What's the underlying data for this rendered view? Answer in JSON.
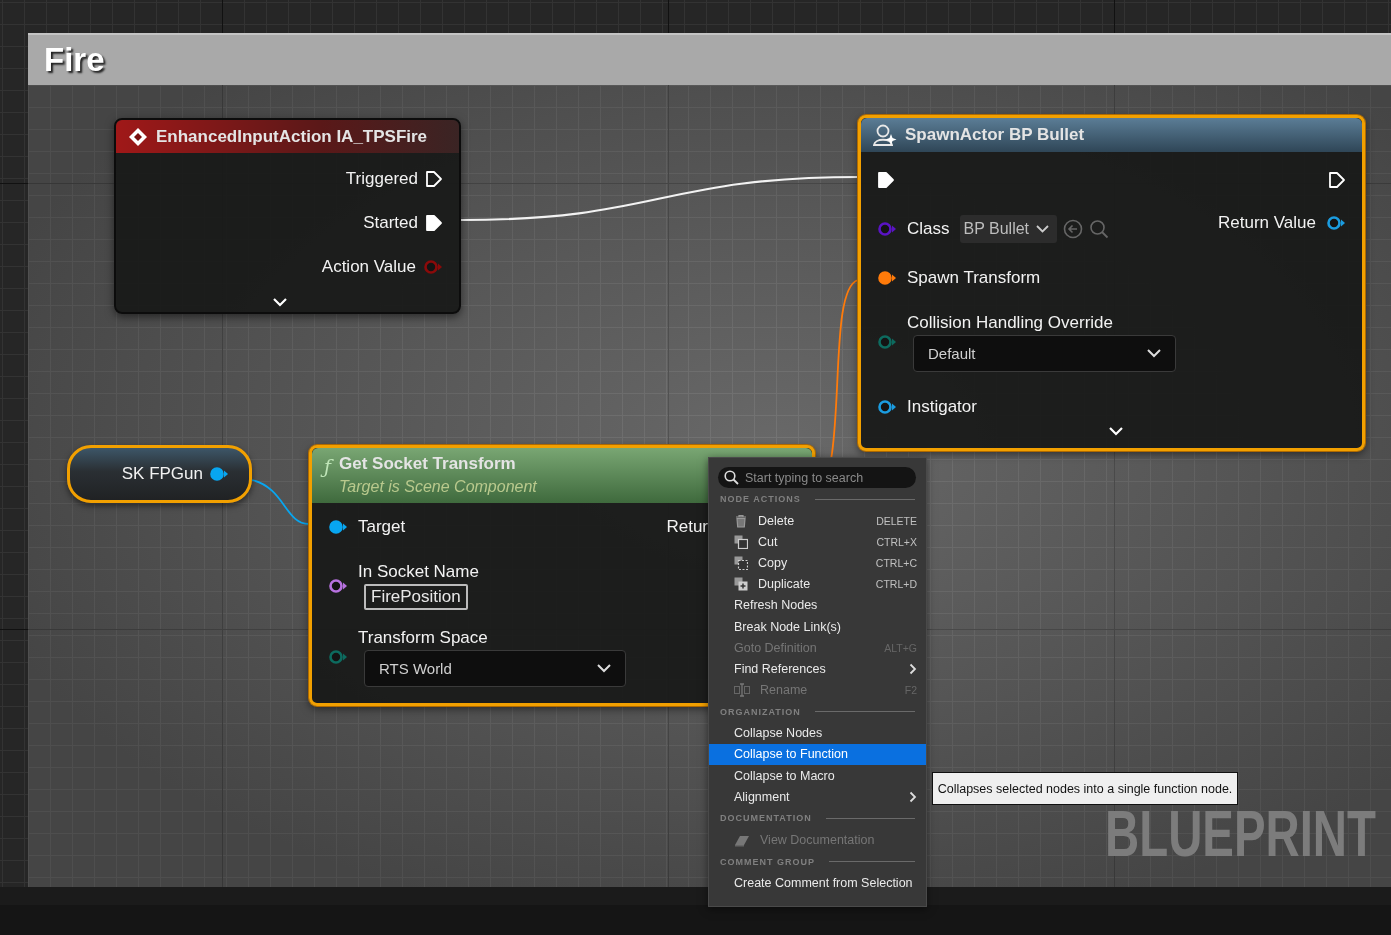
{
  "comment": {
    "title": "Fire"
  },
  "event_node": {
    "title": "EnhancedInputAction IA_TPSFire",
    "selected": false,
    "expandable": true,
    "outputs": [
      {
        "label": "Triggered",
        "kind": "exec",
        "connected": false
      },
      {
        "label": "Started",
        "kind": "exec",
        "connected": true
      },
      {
        "label": "Action Value",
        "kind": "data",
        "color": "#8b0a0a",
        "connected": false
      }
    ]
  },
  "spawn_node": {
    "title": "SpawnActor BP Bullet",
    "selected": true,
    "expandable": true,
    "inputs": [
      {
        "kind": "exec",
        "connected": true
      },
      {
        "label": "Class",
        "kind": "data",
        "color": "#5a14c4",
        "connected": false,
        "combo": "BP Bullet"
      },
      {
        "label": "Spawn Transform",
        "kind": "data",
        "color": "#ff7b0a",
        "connected": true
      },
      {
        "label": "Collision Handling Override",
        "kind": "data",
        "color": "#0d6b5f",
        "connected": false,
        "dropdown": "Default"
      },
      {
        "label": "Instigator",
        "kind": "data",
        "color": "#1b9ce0",
        "connected": false
      }
    ],
    "outputs": [
      {
        "kind": "exec",
        "connected": false
      },
      {
        "label": "Return Value",
        "kind": "data",
        "color": "#1b9ce0",
        "connected": false
      }
    ]
  },
  "variable_node": {
    "label": "SK FPGun",
    "selected": true,
    "pin": {
      "kind": "data",
      "color": "#08a6f0",
      "connected": true
    }
  },
  "function_node": {
    "glyph": "ƒ",
    "title": "Get Socket Transform",
    "subtitle": "Target is Scene Component",
    "selected": true,
    "inputs": [
      {
        "label": "Target",
        "kind": "data",
        "color": "#08a6f0",
        "connected": true
      },
      {
        "label": "In Socket Name",
        "kind": "data",
        "color": "#b872e0",
        "connected": false,
        "text_value": "FirePosition"
      },
      {
        "label": "Transform Space",
        "kind": "data",
        "color": "#0d6b5f",
        "connected": false,
        "dropdown": "RTS World"
      }
    ],
    "outputs": [
      {
        "label": "Retur"
      }
    ]
  },
  "context_menu": {
    "search_placeholder": "Start typing to search",
    "entries": [
      {
        "kind": "heading",
        "label": "NODE ACTIONS"
      },
      {
        "kind": "item",
        "label": "Delete",
        "shortcut": "DELETE",
        "disabled": false,
        "selected": false
      },
      {
        "kind": "item",
        "label": "Cut",
        "shortcut": "CTRL+X",
        "disabled": false,
        "selected": false
      },
      {
        "kind": "item",
        "label": "Copy",
        "shortcut": "CTRL+C",
        "disabled": false,
        "selected": false
      },
      {
        "kind": "item",
        "label": "Duplicate",
        "shortcut": "CTRL+D",
        "disabled": false,
        "selected": false
      },
      {
        "kind": "item",
        "label": "Refresh Nodes",
        "disabled": false,
        "selected": false
      },
      {
        "kind": "item",
        "label": "Break Node Link(s)",
        "disabled": false,
        "selected": false
      },
      {
        "kind": "item",
        "label": "Goto Definition",
        "shortcut": "ALT+G",
        "disabled": true,
        "selected": false
      },
      {
        "kind": "item",
        "label": "Find References",
        "submenu": true,
        "disabled": false,
        "selected": false
      },
      {
        "kind": "item",
        "label": "Rename",
        "shortcut": "F2",
        "disabled": true,
        "selected": false
      },
      {
        "kind": "heading",
        "label": "ORGANIZATION"
      },
      {
        "kind": "item",
        "label": "Collapse Nodes",
        "disabled": false,
        "selected": false
      },
      {
        "kind": "item",
        "label": "Collapse to Function",
        "disabled": false,
        "selected": true
      },
      {
        "kind": "item",
        "label": "Collapse to Macro",
        "disabled": false,
        "selected": false
      },
      {
        "kind": "item",
        "label": "Alignment",
        "submenu": true,
        "disabled": false,
        "selected": false
      },
      {
        "kind": "heading",
        "label": "DOCUMENTATION"
      },
      {
        "kind": "item",
        "label": "View Documentation",
        "disabled": true,
        "selected": false
      },
      {
        "kind": "heading",
        "label": "COMMENT GROUP"
      },
      {
        "kind": "item",
        "label": "Create Comment from Selection",
        "disabled": false,
        "selected": false
      }
    ]
  },
  "tooltip": {
    "text": "Collapses selected nodes into a single function node."
  },
  "graph_label": "BLUEPRINT"
}
